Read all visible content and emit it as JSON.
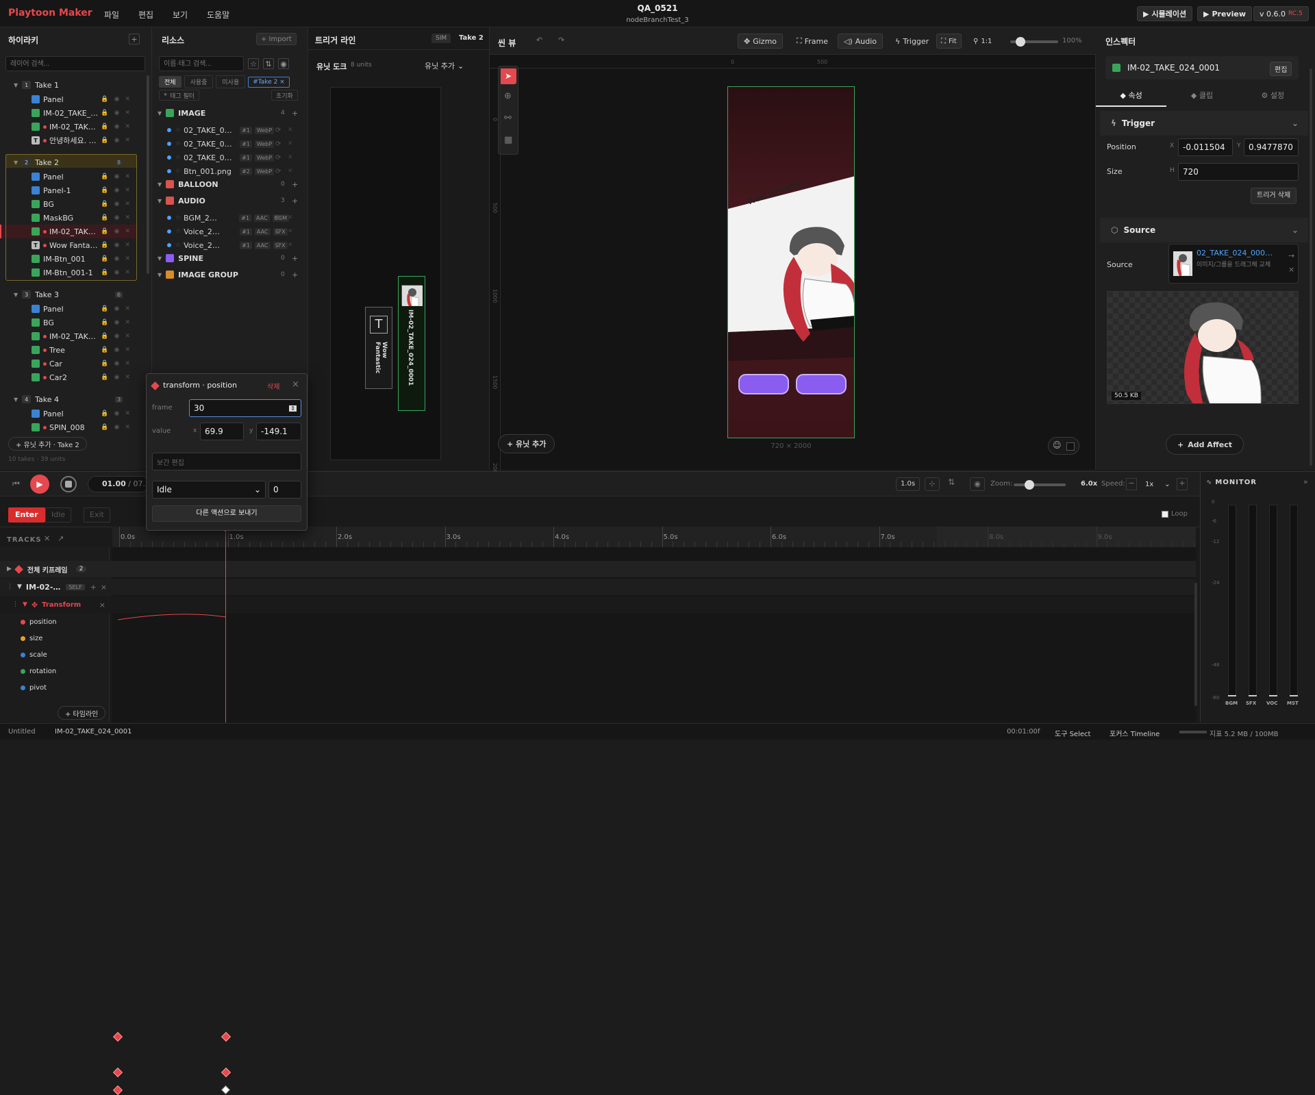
{
  "app": {
    "name": "Playtoon Maker",
    "project": "QA_0521",
    "file": "nodeBranchTest_3",
    "version": "v 0.6.0",
    "version_tag": "RC.5"
  },
  "menu": [
    "파일",
    "편집",
    "보기",
    "도움말"
  ],
  "topbar": {
    "simulation": "시뮬레이션",
    "preview": "Preview"
  },
  "hierarchy": {
    "title": "하이라키",
    "add": "+",
    "search_placeholder": "레이어 검색...",
    "takes": [
      {
        "num": "1",
        "name": "Take 1",
        "items": [
          {
            "type": "p",
            "label": "Panel"
          },
          {
            "type": "i",
            "label": "IM-02_TAKE_…",
            "dot": false
          },
          {
            "type": "i",
            "label": "IM-02_TAK…",
            "dot": true
          },
          {
            "type": "t",
            "label": "안녕하세요. …",
            "dot": true
          }
        ]
      },
      {
        "num": "2",
        "name": "Take 2",
        "count": "8",
        "items": [
          {
            "type": "p",
            "label": "Panel"
          },
          {
            "type": "p",
            "label": "Panel-1"
          },
          {
            "type": "i",
            "label": "BG"
          },
          {
            "type": "i",
            "label": "MaskBG"
          },
          {
            "type": "i",
            "label": "IM-02_TAK…",
            "dot": true
          },
          {
            "type": "t",
            "label": "Wow Fanta…",
            "dot": true
          },
          {
            "type": "i",
            "label": "IM-Btn_001"
          },
          {
            "type": "i",
            "label": "IM-Btn_001-1"
          }
        ]
      },
      {
        "num": "3",
        "name": "Take 3",
        "count": "6",
        "items": [
          {
            "type": "p",
            "label": "Panel"
          },
          {
            "type": "i",
            "label": "BG"
          },
          {
            "type": "i",
            "label": "IM-02_TAK…",
            "dot": true
          },
          {
            "type": "i",
            "label": "Tree",
            "dot": true
          },
          {
            "type": "i",
            "label": "Car",
            "dot": true
          },
          {
            "type": "i",
            "label": "Car2",
            "dot": true
          }
        ]
      },
      {
        "num": "4",
        "name": "Take 4",
        "count": "3",
        "items": [
          {
            "type": "p",
            "label": "Panel"
          },
          {
            "type": "i",
            "label": "SPIN_008",
            "dot": true
          }
        ]
      }
    ],
    "add_unit": "+ 유닛 추가 · Take 2",
    "footer": "10 takes · 39 units"
  },
  "resources": {
    "title": "리소스",
    "import": "+ Import",
    "search_placeholder": "이름·태그 검색...",
    "filters": [
      "전체",
      "사용중",
      "미사용"
    ],
    "active_tag": "#Take 2 ×",
    "tag_filter": "태그 필터",
    "reset": "초기화",
    "categories": [
      {
        "name": "IMAGE",
        "count": "4",
        "color": "#3aa55a",
        "items": [
          {
            "name": "02_TAKE_0…",
            "n": "#1",
            "fmt": "WebP"
          },
          {
            "name": "02_TAKE_0…",
            "n": "#1",
            "fmt": "WebP"
          },
          {
            "name": "02_TAKE_0…",
            "n": "#1",
            "fmt": "WebP"
          },
          {
            "name": "Btn_001.png",
            "n": "#2",
            "fmt": "WebP"
          }
        ]
      },
      {
        "name": "BALLOON",
        "count": "0",
        "color": "#d9534f",
        "items": []
      },
      {
        "name": "AUDIO",
        "count": "3",
        "color": "#d9534f",
        "items": [
          {
            "name": "BGM_2…",
            "n": "#1",
            "fmt": "AAC",
            "fmt2": "BGM"
          },
          {
            "name": "Voice_2…",
            "n": "#1",
            "fmt": "AAC",
            "fmt2": "SFX"
          },
          {
            "name": "Voice_2…",
            "n": "#1",
            "fmt": "AAC",
            "fmt2": "SFX"
          }
        ]
      },
      {
        "name": "SPINE",
        "count": "0",
        "color": "#8b5cf6",
        "items": []
      },
      {
        "name": "IMAGE GROUP",
        "count": "0",
        "color": "#d98a2b",
        "items": []
      }
    ]
  },
  "triggerline": {
    "title": "트리거 라인",
    "sim": "SIM",
    "take": "Take 2",
    "dock": "유닛 도크",
    "units": "8 units",
    "add": "유닛 추가",
    "unit_text": "Wow Fantastic",
    "unit_image": "IM-02_TAKE_024_0001"
  },
  "popup": {
    "title": "transform · position",
    "delete": "삭제",
    "frame_label": "frame",
    "frame_value": "30",
    "value_label": "value",
    "x": "69.9",
    "y": "-149.1",
    "interp": "보간 편집",
    "select": "Idle",
    "select_num": "0",
    "send": "다른 액션으로 보내기"
  },
  "scene": {
    "title": "씬 뷰",
    "gizmo": "Gizmo",
    "frame": "Frame",
    "audio": "Audio",
    "trigger": "Trigger",
    "fit": "Fit",
    "ratio": "1:1",
    "zoom": "100%",
    "canvas_size": "720 × 2000",
    "add_unit": "+ 유닛 추가",
    "bubble_text": "Wow Fantastic!",
    "ruler_h": [
      "0",
      "500"
    ],
    "ruler_v": [
      "0",
      "500",
      "1000",
      "1500",
      "2000"
    ]
  },
  "inspector": {
    "title": "인스펙터",
    "unit_name": "IM-02_TAKE_024_0001",
    "edit": "편집",
    "tabs": [
      "속성",
      "클립",
      "설정"
    ],
    "trigger": {
      "title": "Trigger",
      "position_label": "Position",
      "x": "-0.011504",
      "y": "0.9477870",
      "size_label": "Size",
      "h": "720",
      "delete": "트리거 삭제"
    },
    "source": {
      "title": "Source",
      "label": "Source",
      "file": "02_TAKE_024_000…",
      "hint": "이미지/그룹을 드래그해 교체",
      "size": "50.5 KB"
    },
    "add_affect": "Add Affect"
  },
  "transport": {
    "time": "01.00",
    "time2": "07.5",
    "step": "1.0s",
    "zoom_label": "Zoom:",
    "zoom_val": "6.0x",
    "speed_label": "Speed:",
    "speed": "1x",
    "loop": "Loop"
  },
  "actions": [
    "Enter",
    "Idle",
    "Exit"
  ],
  "timeline": {
    "tracks_label": "TRACKS",
    "ruler": [
      "0.0s",
      "1.0s",
      "2.0s",
      "3.0s",
      "4.0s",
      "5.0s",
      "6.0s",
      "7.0s",
      "8.0s",
      "9.0s"
    ],
    "all_kf": "전체 키프레임",
    "all_kf_count": "2",
    "unit": "IM-02-…",
    "self": "SELF",
    "transform": "Transform",
    "props": [
      {
        "name": "position",
        "color": "#e5484d"
      },
      {
        "name": "size",
        "color": "#e5a02b"
      },
      {
        "name": "scale",
        "color": "#3b82d4"
      },
      {
        "name": "rotation",
        "color": "#3aa55a"
      },
      {
        "name": "pivot",
        "color": "#3b82d4"
      }
    ],
    "add_timeline": "+ 타임라인"
  },
  "monitor": {
    "title": "MONITOR",
    "scale": [
      "0",
      "-6",
      "-12",
      "-24",
      "-48",
      "-60"
    ],
    "channels": [
      "BGM",
      "SFX",
      "VOC",
      "MST"
    ]
  },
  "status": {
    "doc": "Untitled",
    "selected": "IM-02_TAKE_024_0001",
    "time": "00:01:00f",
    "tool": "도구 Select",
    "focus": "포커스 Timeline",
    "memory": "지표 5.2 MB / 100MB"
  }
}
